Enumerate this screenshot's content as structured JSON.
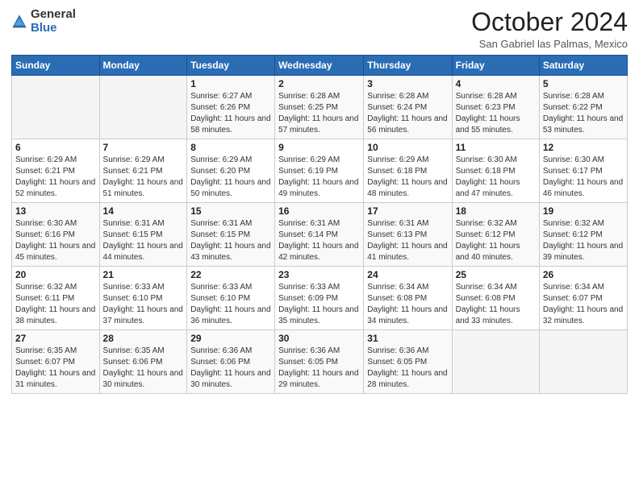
{
  "logo": {
    "general": "General",
    "blue": "Blue"
  },
  "header": {
    "month": "October 2024",
    "location": "San Gabriel las Palmas, Mexico"
  },
  "weekdays": [
    "Sunday",
    "Monday",
    "Tuesday",
    "Wednesday",
    "Thursday",
    "Friday",
    "Saturday"
  ],
  "weeks": [
    [
      {
        "day": "",
        "info": ""
      },
      {
        "day": "",
        "info": ""
      },
      {
        "day": "1",
        "info": "Sunrise: 6:27 AM\nSunset: 6:26 PM\nDaylight: 11 hours and 58 minutes."
      },
      {
        "day": "2",
        "info": "Sunrise: 6:28 AM\nSunset: 6:25 PM\nDaylight: 11 hours and 57 minutes."
      },
      {
        "day": "3",
        "info": "Sunrise: 6:28 AM\nSunset: 6:24 PM\nDaylight: 11 hours and 56 minutes."
      },
      {
        "day": "4",
        "info": "Sunrise: 6:28 AM\nSunset: 6:23 PM\nDaylight: 11 hours and 55 minutes."
      },
      {
        "day": "5",
        "info": "Sunrise: 6:28 AM\nSunset: 6:22 PM\nDaylight: 11 hours and 53 minutes."
      }
    ],
    [
      {
        "day": "6",
        "info": "Sunrise: 6:29 AM\nSunset: 6:21 PM\nDaylight: 11 hours and 52 minutes."
      },
      {
        "day": "7",
        "info": "Sunrise: 6:29 AM\nSunset: 6:21 PM\nDaylight: 11 hours and 51 minutes."
      },
      {
        "day": "8",
        "info": "Sunrise: 6:29 AM\nSunset: 6:20 PM\nDaylight: 11 hours and 50 minutes."
      },
      {
        "day": "9",
        "info": "Sunrise: 6:29 AM\nSunset: 6:19 PM\nDaylight: 11 hours and 49 minutes."
      },
      {
        "day": "10",
        "info": "Sunrise: 6:29 AM\nSunset: 6:18 PM\nDaylight: 11 hours and 48 minutes."
      },
      {
        "day": "11",
        "info": "Sunrise: 6:30 AM\nSunset: 6:18 PM\nDaylight: 11 hours and 47 minutes."
      },
      {
        "day": "12",
        "info": "Sunrise: 6:30 AM\nSunset: 6:17 PM\nDaylight: 11 hours and 46 minutes."
      }
    ],
    [
      {
        "day": "13",
        "info": "Sunrise: 6:30 AM\nSunset: 6:16 PM\nDaylight: 11 hours and 45 minutes."
      },
      {
        "day": "14",
        "info": "Sunrise: 6:31 AM\nSunset: 6:15 PM\nDaylight: 11 hours and 44 minutes."
      },
      {
        "day": "15",
        "info": "Sunrise: 6:31 AM\nSunset: 6:15 PM\nDaylight: 11 hours and 43 minutes."
      },
      {
        "day": "16",
        "info": "Sunrise: 6:31 AM\nSunset: 6:14 PM\nDaylight: 11 hours and 42 minutes."
      },
      {
        "day": "17",
        "info": "Sunrise: 6:31 AM\nSunset: 6:13 PM\nDaylight: 11 hours and 41 minutes."
      },
      {
        "day": "18",
        "info": "Sunrise: 6:32 AM\nSunset: 6:12 PM\nDaylight: 11 hours and 40 minutes."
      },
      {
        "day": "19",
        "info": "Sunrise: 6:32 AM\nSunset: 6:12 PM\nDaylight: 11 hours and 39 minutes."
      }
    ],
    [
      {
        "day": "20",
        "info": "Sunrise: 6:32 AM\nSunset: 6:11 PM\nDaylight: 11 hours and 38 minutes."
      },
      {
        "day": "21",
        "info": "Sunrise: 6:33 AM\nSunset: 6:10 PM\nDaylight: 11 hours and 37 minutes."
      },
      {
        "day": "22",
        "info": "Sunrise: 6:33 AM\nSunset: 6:10 PM\nDaylight: 11 hours and 36 minutes."
      },
      {
        "day": "23",
        "info": "Sunrise: 6:33 AM\nSunset: 6:09 PM\nDaylight: 11 hours and 35 minutes."
      },
      {
        "day": "24",
        "info": "Sunrise: 6:34 AM\nSunset: 6:08 PM\nDaylight: 11 hours and 34 minutes."
      },
      {
        "day": "25",
        "info": "Sunrise: 6:34 AM\nSunset: 6:08 PM\nDaylight: 11 hours and 33 minutes."
      },
      {
        "day": "26",
        "info": "Sunrise: 6:34 AM\nSunset: 6:07 PM\nDaylight: 11 hours and 32 minutes."
      }
    ],
    [
      {
        "day": "27",
        "info": "Sunrise: 6:35 AM\nSunset: 6:07 PM\nDaylight: 11 hours and 31 minutes."
      },
      {
        "day": "28",
        "info": "Sunrise: 6:35 AM\nSunset: 6:06 PM\nDaylight: 11 hours and 30 minutes."
      },
      {
        "day": "29",
        "info": "Sunrise: 6:36 AM\nSunset: 6:06 PM\nDaylight: 11 hours and 30 minutes."
      },
      {
        "day": "30",
        "info": "Sunrise: 6:36 AM\nSunset: 6:05 PM\nDaylight: 11 hours and 29 minutes."
      },
      {
        "day": "31",
        "info": "Sunrise: 6:36 AM\nSunset: 6:05 PM\nDaylight: 11 hours and 28 minutes."
      },
      {
        "day": "",
        "info": ""
      },
      {
        "day": "",
        "info": ""
      }
    ]
  ]
}
